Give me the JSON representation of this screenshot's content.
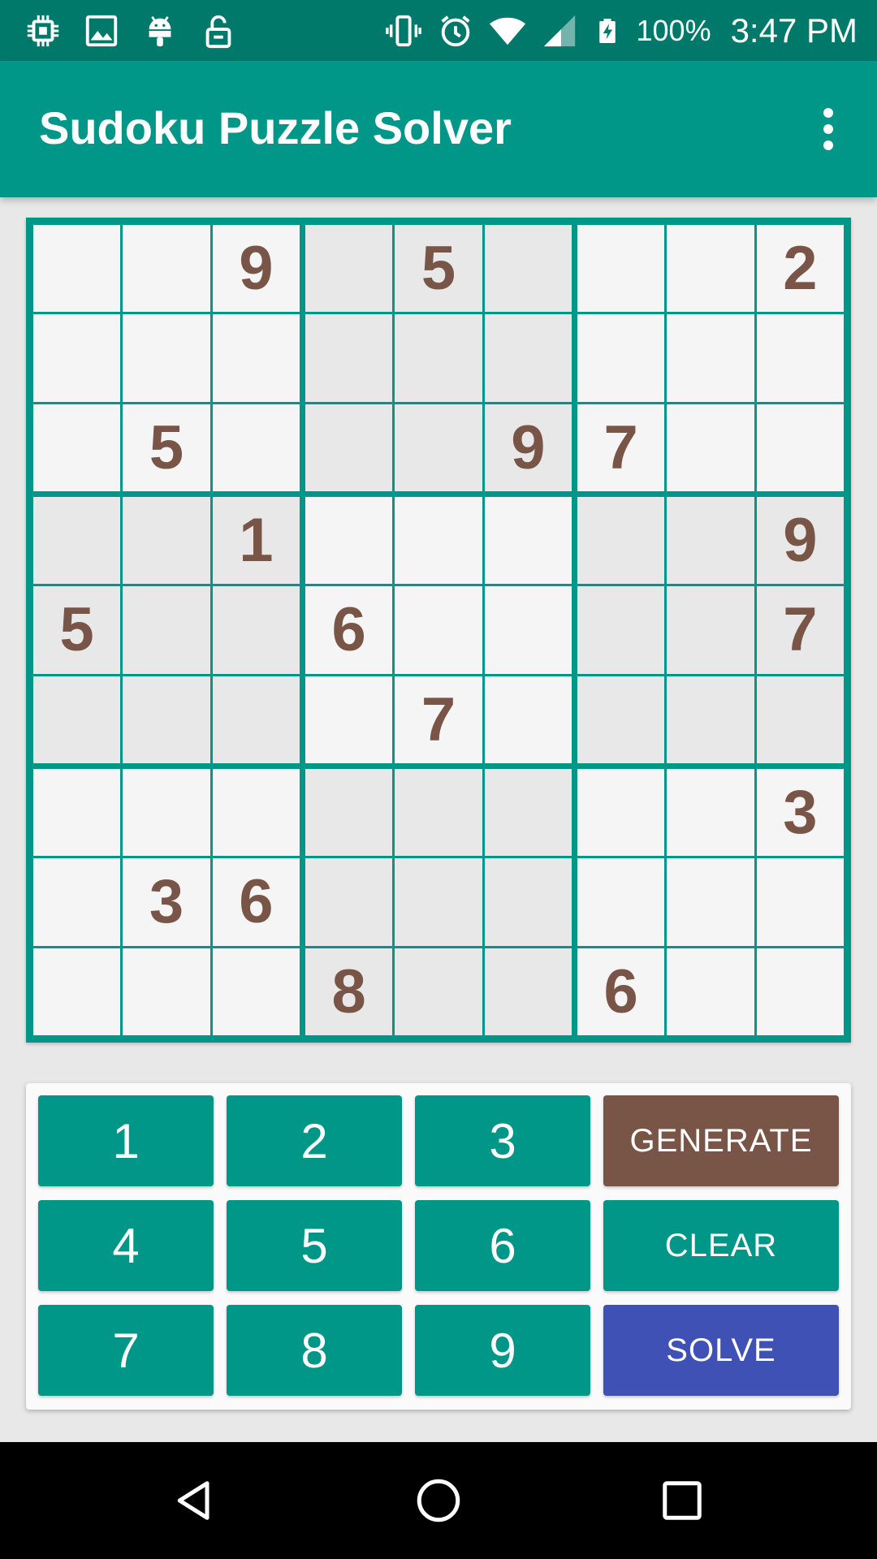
{
  "status_bar": {
    "battery_percent": "100%",
    "time": "3:47 PM",
    "icons": [
      "cpu-icon",
      "image-icon",
      "android-icon",
      "unlock-icon",
      "vibrate-icon",
      "alarm-icon",
      "wifi-icon",
      "cell-signal-icon",
      "battery-charging-icon"
    ]
  },
  "app_bar": {
    "title": "Sudoku Puzzle Solver",
    "overflow_icon": "more-vert-icon"
  },
  "board": {
    "rows": [
      [
        "",
        "",
        "9",
        "",
        "5",
        "",
        "",
        "",
        "2"
      ],
      [
        "",
        "",
        "",
        "",
        "",
        "",
        "",
        "",
        ""
      ],
      [
        "",
        "5",
        "",
        "",
        "",
        "9",
        "7",
        "",
        ""
      ],
      [
        "",
        "",
        "1",
        "",
        "",
        "",
        "",
        "",
        "9"
      ],
      [
        "5",
        "",
        "",
        "6",
        "",
        "",
        "",
        "",
        "7"
      ],
      [
        "",
        "",
        "",
        "",
        "7",
        "",
        "",
        "",
        ""
      ],
      [
        "",
        "",
        "",
        "",
        "",
        "",
        "",
        "",
        "3"
      ],
      [
        "",
        "3",
        "6",
        "",
        "",
        "",
        "",
        "",
        ""
      ],
      [
        "",
        "",
        "",
        "8",
        "",
        "",
        "6",
        "",
        ""
      ]
    ],
    "colors": {
      "border": "#009688",
      "light_cell": "#f5f5f5",
      "dark_cell": "#e8e8e8",
      "digit": "#795548"
    }
  },
  "keypad": {
    "numbers": [
      "1",
      "2",
      "3",
      "4",
      "5",
      "6",
      "7",
      "8",
      "9"
    ],
    "generate_label": "GENERATE",
    "clear_label": "CLEAR",
    "solve_label": "SOLVE",
    "colors": {
      "number": "#009688",
      "generate": "#795548",
      "clear": "#009688",
      "solve": "#3f51b5"
    }
  },
  "nav_bar": {
    "icons": [
      "back-icon",
      "home-icon",
      "recents-icon"
    ]
  }
}
